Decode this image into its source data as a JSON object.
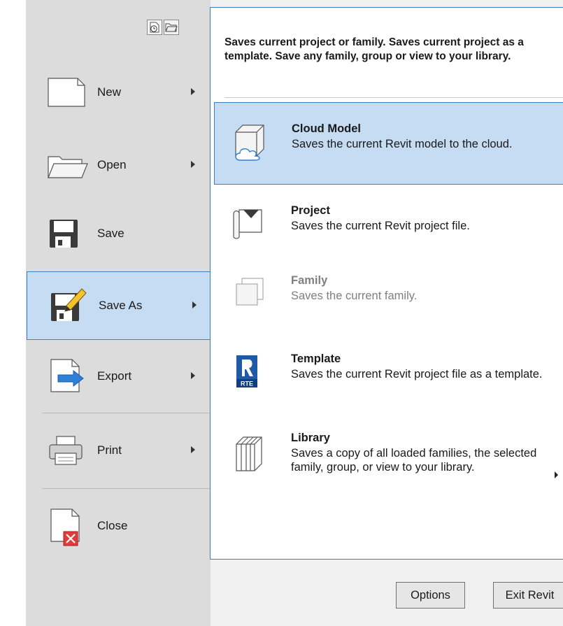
{
  "menu": {
    "items": [
      {
        "label": "New",
        "icon": "new-document-icon",
        "has_submenu": true
      },
      {
        "label": "Open",
        "icon": "open-folder-icon",
        "has_submenu": true
      },
      {
        "label": "Save",
        "icon": "save-disk-icon",
        "has_submenu": false
      },
      {
        "label": "Save As",
        "icon": "save-as-icon",
        "has_submenu": true,
        "selected": true
      },
      {
        "label": "Export",
        "icon": "export-icon",
        "has_submenu": true
      },
      {
        "label": "Print",
        "icon": "printer-icon",
        "has_submenu": true
      },
      {
        "label": "Close",
        "icon": "close-document-icon",
        "has_submenu": false
      }
    ],
    "top_icons": [
      "recent-documents-icon",
      "open-documents-icon"
    ]
  },
  "panel": {
    "description": "Saves current project or family. Saves current project as a template. Save any family, group or view to your library.",
    "items": [
      {
        "title": "Cloud Model",
        "description": "Saves the current Revit model to the cloud.",
        "icon": "cloud-model-icon",
        "selected": true
      },
      {
        "title": "Project",
        "description": "Saves the current Revit project file.",
        "icon": "project-icon"
      },
      {
        "title": "Family",
        "description": "Saves the current family.",
        "icon": "family-icon",
        "disabled": true
      },
      {
        "title": "Template",
        "description": "Saves the current Revit project file as a template.",
        "icon": "template-rte-icon",
        "icon_text": "RTE"
      },
      {
        "title": "Library",
        "description": "Saves a copy of all loaded families, the selected family, group, or view to your library.",
        "icon": "library-icon",
        "has_submenu": true
      }
    ]
  },
  "footer": {
    "options_label": "Options",
    "exit_label": "Exit Revit"
  },
  "colors": {
    "selection_fill": "#c5dcf3",
    "selection_border": "#3c7fc1",
    "menu_background": "#dcdcdc"
  }
}
